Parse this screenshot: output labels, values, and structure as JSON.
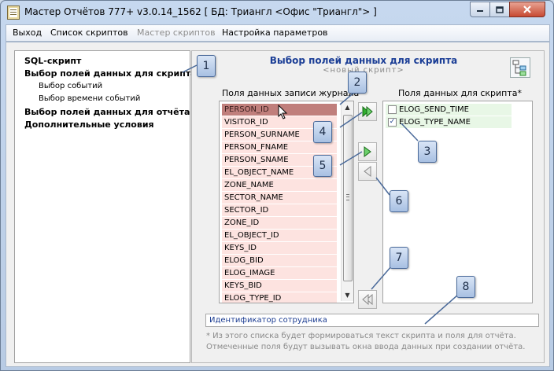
{
  "window": {
    "title": "Мастер Отчётов 777+ v3.0.14_1562 [ БД: Триангл <Офис \"Триангл\"> ]"
  },
  "menu": {
    "items": [
      {
        "label": "Выход",
        "enabled": true
      },
      {
        "label": "Список скриптов",
        "enabled": true
      },
      {
        "label": "Мастер скриптов",
        "enabled": false
      },
      {
        "label": "Настройка параметров",
        "enabled": true
      }
    ]
  },
  "nav": {
    "items": [
      {
        "label": "SQL-скрипт",
        "level": 0
      },
      {
        "label": "Выбор полей данных для скрипта",
        "level": 0
      },
      {
        "label": "Выбор событий",
        "level": 1
      },
      {
        "label": "Выбор времени событий",
        "level": 1
      },
      {
        "label": "Выбор полей данных для отчёта",
        "level": 0
      },
      {
        "label": "Дополнительные условия",
        "level": 0
      }
    ]
  },
  "main": {
    "title": "Выбор полей данных для скрипта",
    "subtitle": "<новый скрипт>",
    "left_header": "Поля данных записи журнала",
    "right_header": "Поля данных для скрипта*",
    "available_fields": [
      "PERSON_ID",
      "VISITOR_ID",
      "PERSON_SURNAME",
      "PERSON_FNAME",
      "PERSON_SNAME",
      "EL_OBJECT_NAME",
      "ZONE_NAME",
      "SECTOR_NAME",
      "SECTOR_ID",
      "ZONE_ID",
      "EL_OBJECT_ID",
      "KEYS_ID",
      "ELOG_BID",
      "ELOG_IMAGE",
      "KEYS_BID",
      "ELOG_TYPE_ID"
    ],
    "selected_index": 0,
    "script_fields": [
      {
        "name": "ELOG_SEND_TIME",
        "checked": false
      },
      {
        "name": "ELOG_TYPE_NAME",
        "checked": true
      }
    ],
    "field_description": "Идентификатор сотрудника",
    "footnote_line1": "* Из этого списка будет формироваться текст скрипта и поля для отчёта.",
    "footnote_line2": "Отмеченные поля будут вызывать окна ввода данных при создании отчёта."
  },
  "callouts": [
    "1",
    "2",
    "3",
    "4",
    "5",
    "6",
    "7",
    "8"
  ],
  "icons": {
    "add_all": "double-arrow-right-icon",
    "add_one": "arrow-right-icon",
    "remove_one": "arrow-left-icon",
    "remove_all": "double-arrow-left-icon"
  },
  "colors": {
    "accent_title": "#1b3e96",
    "selected_row": "#c07f7c",
    "available_row": "#fde3e0",
    "script_row": "#e8f7e6",
    "arrow_green": "#2fae2f"
  }
}
